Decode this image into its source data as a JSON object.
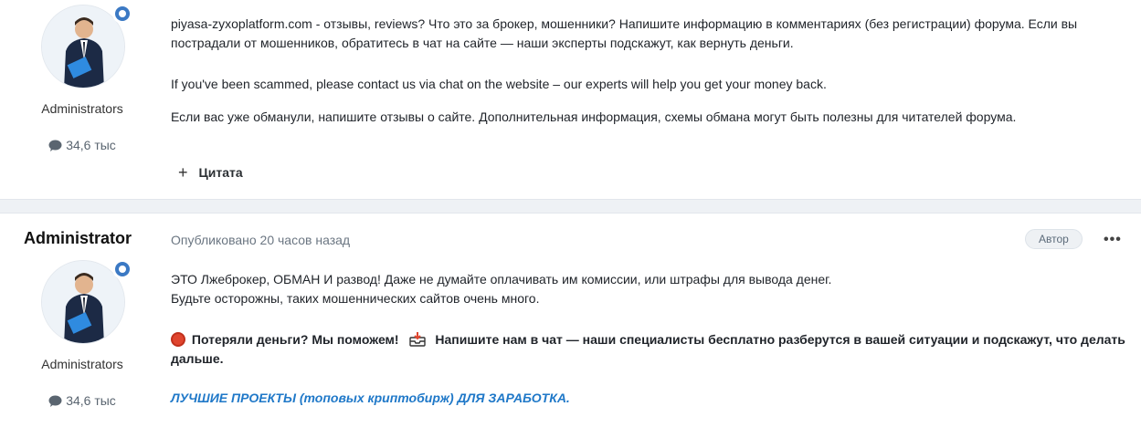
{
  "post1": {
    "group": "Administrators",
    "post_count": "34,6 тыс",
    "paragraphs": [
      "piyasa-zyxoplatform.com - отзывы, reviews? Что это за брокер, мошенники? Напишите информацию в комментариях (без регистрации) форума. Если вы пострадали от мошенников, обратитесь в чат на сайте — наши эксперты подскажут, как вернуть деньги.",
      "If you've been scammed, please contact us via chat on the website – our experts will help you get your money back.",
      "Если вас уже обманули, напишите отзывы о сайте. Дополнительная информация, схемы обмана могут быть полезны для читателей форума."
    ],
    "quote_label": "Цитата"
  },
  "post2": {
    "author": "Administrator",
    "group": "Administrators",
    "post_count": "34,6 тыс",
    "timestamp": "Опубликовано 20 часов назад",
    "author_badge": "Автор",
    "more": "•••",
    "line1": "ЭТО Лжеброкер, ОБМАН И развод! Даже не думайте оплачивать им комиссии, или штрафы для вывода денег.",
    "line2": "Будьте осторожны, таких мошеннических сайтов очень много.",
    "bold_part1": "Потеряли деньги? Мы поможем!",
    "bold_part2": "Напишите нам в чат  — наши специалисты бесплатно разберутся в вашей ситуации и подскажут, что делать дальше.",
    "link_text": "ЛУЧШИЕ ПРОЕКТЫ (топовых криптобирж) ДЛЯ ЗАРАБОТКА."
  },
  "icons": {
    "chat": "chat-bubble-icon",
    "online": "online-indicator-icon",
    "plus": "plus-icon",
    "red_circle": "red-circle-icon",
    "inbox": "inbox-tray-icon"
  },
  "colors": {
    "link": "#1f78c8",
    "separator": "#eef1f5",
    "online_ring": "#3b79c4"
  }
}
